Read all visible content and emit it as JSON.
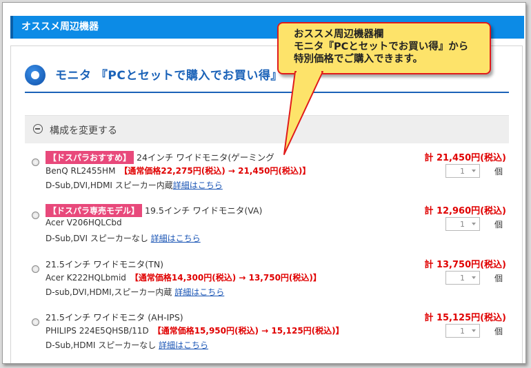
{
  "header": {
    "title": "オススメ周辺機器"
  },
  "section": {
    "title": "モニタ 『PCとセットで購入でお買い得』"
  },
  "config": {
    "label": "構成を変更する"
  },
  "callout": {
    "lines": [
      "おススメ周辺機器欄",
      "モニタ『PCとセットでお買い得』から",
      "特別価格でご購入できます。"
    ]
  },
  "products": [
    {
      "badge": "【ドスパラおすすめ】",
      "name": "24インチ ワイドモニタ(ゲーミング",
      "model": "BenQ RL2455HM",
      "note": "【通常価格22,275円(税込) → 21,450円(税込)】",
      "features": "D-Sub,DVI,HDMI スピーカー内蔵",
      "link": "詳細はこちら",
      "price": "計 21,450円(税込)",
      "qty": "1",
      "unit": "個"
    },
    {
      "badge": "【ドスパラ専売モデル】",
      "name": "19.5インチ ワイドモニタ(VA)",
      "model": "Acer V206HQLCbd",
      "note": "",
      "features": "D-Sub,DVI スピーカーなし",
      "link": "詳細はこちら",
      "price": "計 12,960円(税込)",
      "qty": "1",
      "unit": "個"
    },
    {
      "badge": "",
      "name": "21.5インチ ワイドモニタ(TN)",
      "model": "Acer K222HQLbmid",
      "note": "【通常価格14,300円(税込) → 13,750円(税込)】",
      "features": "D-sub,DVI,HDMI,スピーカー内蔵",
      "link": "詳細はこちら",
      "price": "計 13,750円(税込)",
      "qty": "1",
      "unit": "個"
    },
    {
      "badge": "",
      "name": "21.5インチ ワイドモニタ (AH-IPS)",
      "model": "PHILIPS 224E5QHSB/11D",
      "note": "【通常価格15,950円(税込) → 15,125円(税込)】",
      "features": "D-Sub,HDMI スピーカーなし",
      "link": "詳細はこちら",
      "price": "計 15,125円(税込)",
      "qty": "1",
      "unit": "個"
    }
  ],
  "colors": {
    "header_bg": "#0c8be6",
    "accent": "#1a62b8",
    "price": "#e00000",
    "badge": "#e8497b",
    "callout_bg": "#fde36a",
    "callout_border": "#e01a1a"
  }
}
